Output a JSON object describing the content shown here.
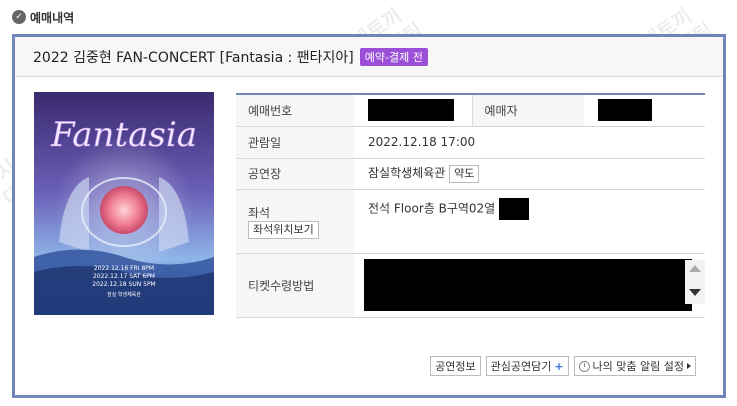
{
  "section": {
    "title": "예매내역",
    "icon": "check-circle-icon"
  },
  "booking": {
    "title": "2022 김중현 FAN-CONCERT [Fantasia : 팬타지아]",
    "status": "예약-결제 전",
    "status_color": "#9a4fd6"
  },
  "poster": {
    "title": "Fantasia",
    "dates": [
      "2022.12.16 FRI 8PM",
      "2022.12.17 SAT 6PM",
      "2022.12.18 SUN 5PM"
    ],
    "venue": "잠실 학생체육관"
  },
  "details": {
    "booking_number_label": "예매번호",
    "booker_label": "예매자",
    "date_label": "관람일",
    "date_value": "2022.12.18 17:00",
    "venue_label": "공연장",
    "venue_value": "잠실학생체육관",
    "map_button": "약도",
    "seat_label": "좌석",
    "seat_position_button": "좌석위치보기",
    "seat_value": "전석 Floor층 B구역02열",
    "ticket_method_label": "티켓수령방법"
  },
  "actions": {
    "show_info": "공연정보",
    "add_interest": "관심공연담기",
    "alarm_settings": "나의 맞춤 알림 설정"
  },
  "watermark": "시계토끼\n대리티켓팅"
}
